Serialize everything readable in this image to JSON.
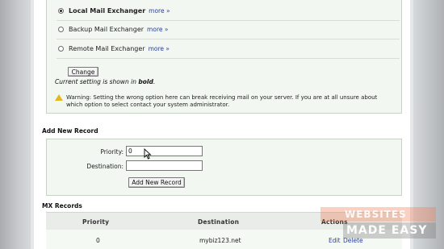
{
  "mail_exchanger": {
    "options": [
      {
        "label": "Local Mail Exchanger",
        "more": "more »",
        "selected": true
      },
      {
        "label": "Backup Mail Exchanger",
        "more": "more »",
        "selected": false
      },
      {
        "label": "Remote Mail Exchanger",
        "more": "more »",
        "selected": false
      }
    ],
    "change_button": "Change",
    "current_note_prefix": "Current setting is shown in ",
    "current_note_bold": "bold",
    "current_note_suffix": ".",
    "warning": "Warning: Setting the wrong option here can break receiving mail on your server. If you are at all unsure about which option to select contact your system administrator."
  },
  "add_record": {
    "title": "Add New Record",
    "priority_label": "Priority:",
    "priority_value": "0",
    "destination_label": "Destination:",
    "destination_value": "",
    "button": "Add New Record"
  },
  "mx_records": {
    "title": "MX Records",
    "columns": [
      "Priority",
      "Destination",
      "Actions"
    ],
    "rows": [
      {
        "priority": "0",
        "destination": "mybiz123.net",
        "edit": "Edit",
        "delete": "Delete"
      }
    ]
  },
  "watermark": {
    "line1": "WEBSITES",
    "line2": "MADE EASY"
  }
}
